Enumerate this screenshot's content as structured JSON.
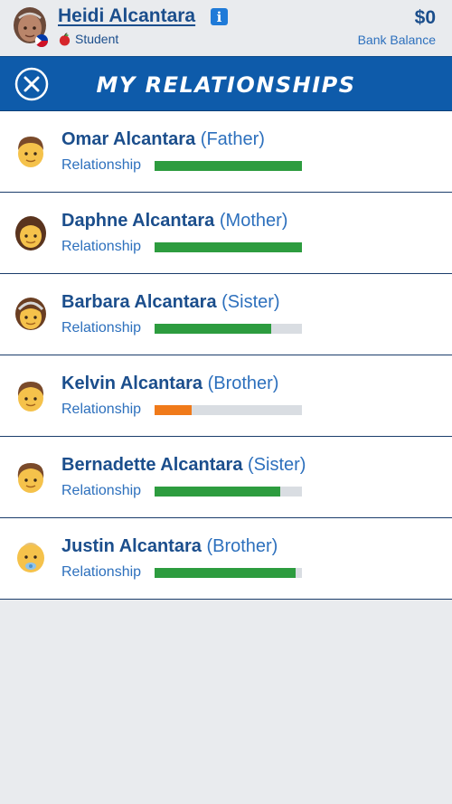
{
  "player": {
    "name": "Heidi Alcantara",
    "occupation": "Student",
    "balance": "$0",
    "balance_label": "Bank Balance",
    "info_icon": "info-icon",
    "flag_icon": "philippines-flag-icon",
    "occupation_icon": "apple-icon"
  },
  "header": {
    "title": "MY RELATIONSHIPS",
    "close_icon": "close-icon"
  },
  "colors": {
    "primary": "#0e5baa",
    "text_dark": "#1b4e8c",
    "text_light": "#2d70bd",
    "bar_good": "#2d9c3f",
    "bar_low": "#f07a1a",
    "bar_track": "#d9dde2"
  },
  "relationships": [
    {
      "name": "Omar Alcantara",
      "relation": "(Father)",
      "label": "Relationship",
      "level": 1.0,
      "color": "#2d9c3f",
      "avatar": "man-avatar-icon"
    },
    {
      "name": "Daphne Alcantara",
      "relation": "(Mother)",
      "label": "Relationship",
      "level": 1.0,
      "color": "#2d9c3f",
      "avatar": "woman-avatar-icon"
    },
    {
      "name": "Barbara Alcantara",
      "relation": "(Sister)",
      "label": "Relationship",
      "level": 0.79,
      "color": "#2d9c3f",
      "avatar": "girl-avatar-icon"
    },
    {
      "name": "Kelvin Alcantara",
      "relation": "(Brother)",
      "label": "Relationship",
      "level": 0.25,
      "color": "#f07a1a",
      "avatar": "boy-avatar-icon"
    },
    {
      "name": "Bernadette Alcantara",
      "relation": "(Sister)",
      "label": "Relationship",
      "level": 0.85,
      "color": "#2d9c3f",
      "avatar": "child-avatar-icon"
    },
    {
      "name": "Justin Alcantara",
      "relation": "(Brother)",
      "label": "Relationship",
      "level": 0.96,
      "color": "#2d9c3f",
      "avatar": "baby-avatar-icon"
    }
  ]
}
